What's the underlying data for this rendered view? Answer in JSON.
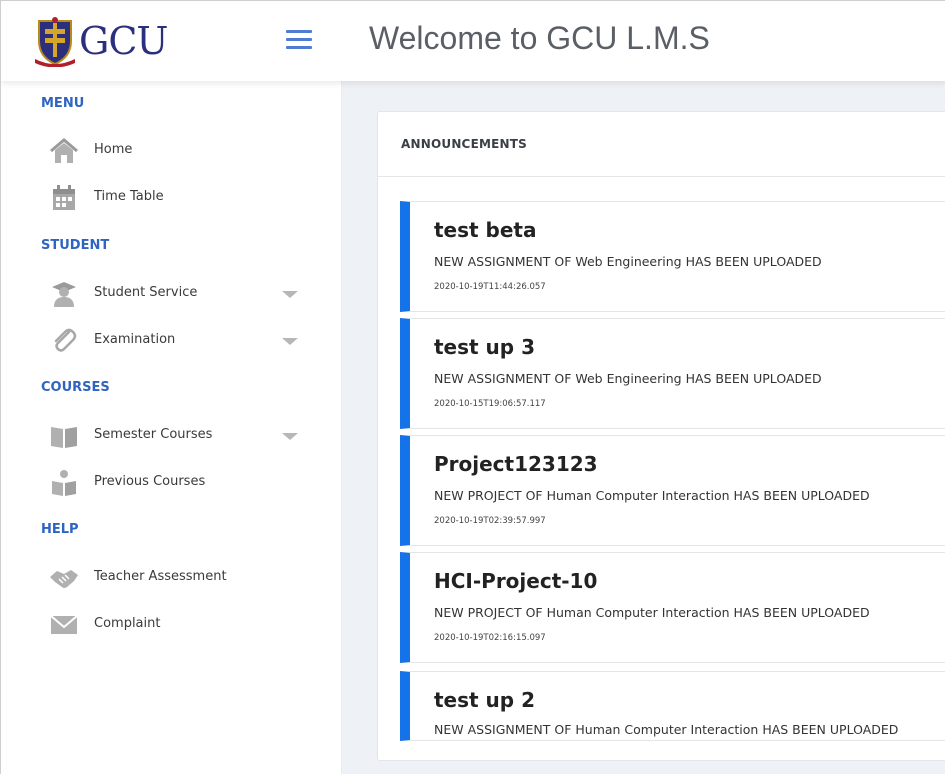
{
  "header": {
    "brand_text": "GCU",
    "welcome_title": "Welcome to GCU L.M.S"
  },
  "sidebar": {
    "sections": [
      {
        "title": "MENU",
        "items": [
          {
            "label": "Home",
            "icon": "home-icon"
          },
          {
            "label": "Time Table",
            "icon": "calendar-icon"
          }
        ]
      },
      {
        "title": "STUDENT",
        "items": [
          {
            "label": "Student Service",
            "icon": "graduate-icon",
            "expandable": true
          },
          {
            "label": "Examination",
            "icon": "paperclip-icon",
            "expandable": true
          }
        ]
      },
      {
        "title": "COURSES",
        "items": [
          {
            "label": "Semester Courses",
            "icon": "book-icon",
            "expandable": true
          },
          {
            "label": "Previous Courses",
            "icon": "reader-icon"
          }
        ]
      },
      {
        "title": "HELP",
        "items": [
          {
            "label": "Teacher Assessment",
            "icon": "handshake-icon"
          },
          {
            "label": "Complaint",
            "icon": "envelope-icon"
          }
        ]
      }
    ]
  },
  "announcements": {
    "title": "ANNOUNCEMENTS",
    "items": [
      {
        "title": "test beta",
        "message": "NEW ASSIGNMENT OF Web Engineering HAS BEEN UPLOADED",
        "date": "2020-10-19T11:44:26.057"
      },
      {
        "title": "test up 3",
        "message": "NEW ASSIGNMENT OF Web Engineering HAS BEEN UPLOADED",
        "date": "2020-10-15T19:06:57.117"
      },
      {
        "title": "Project123123",
        "message": "NEW PROJECT OF Human Computer Interaction HAS BEEN UPLOADED",
        "date": "2020-10-19T02:39:57.997"
      },
      {
        "title": "HCI-Project-10",
        "message": "NEW PROJECT OF Human Computer Interaction HAS BEEN UPLOADED",
        "date": "2020-10-19T02:16:15.097"
      },
      {
        "title": "test up 2",
        "message": "NEW ASSIGNMENT OF Human Computer Interaction HAS BEEN UPLOADED",
        "date": ""
      }
    ]
  },
  "colors": {
    "accent": "#1573ea",
    "section_title": "#2f64c2",
    "main_bg": "#eef1f5"
  }
}
